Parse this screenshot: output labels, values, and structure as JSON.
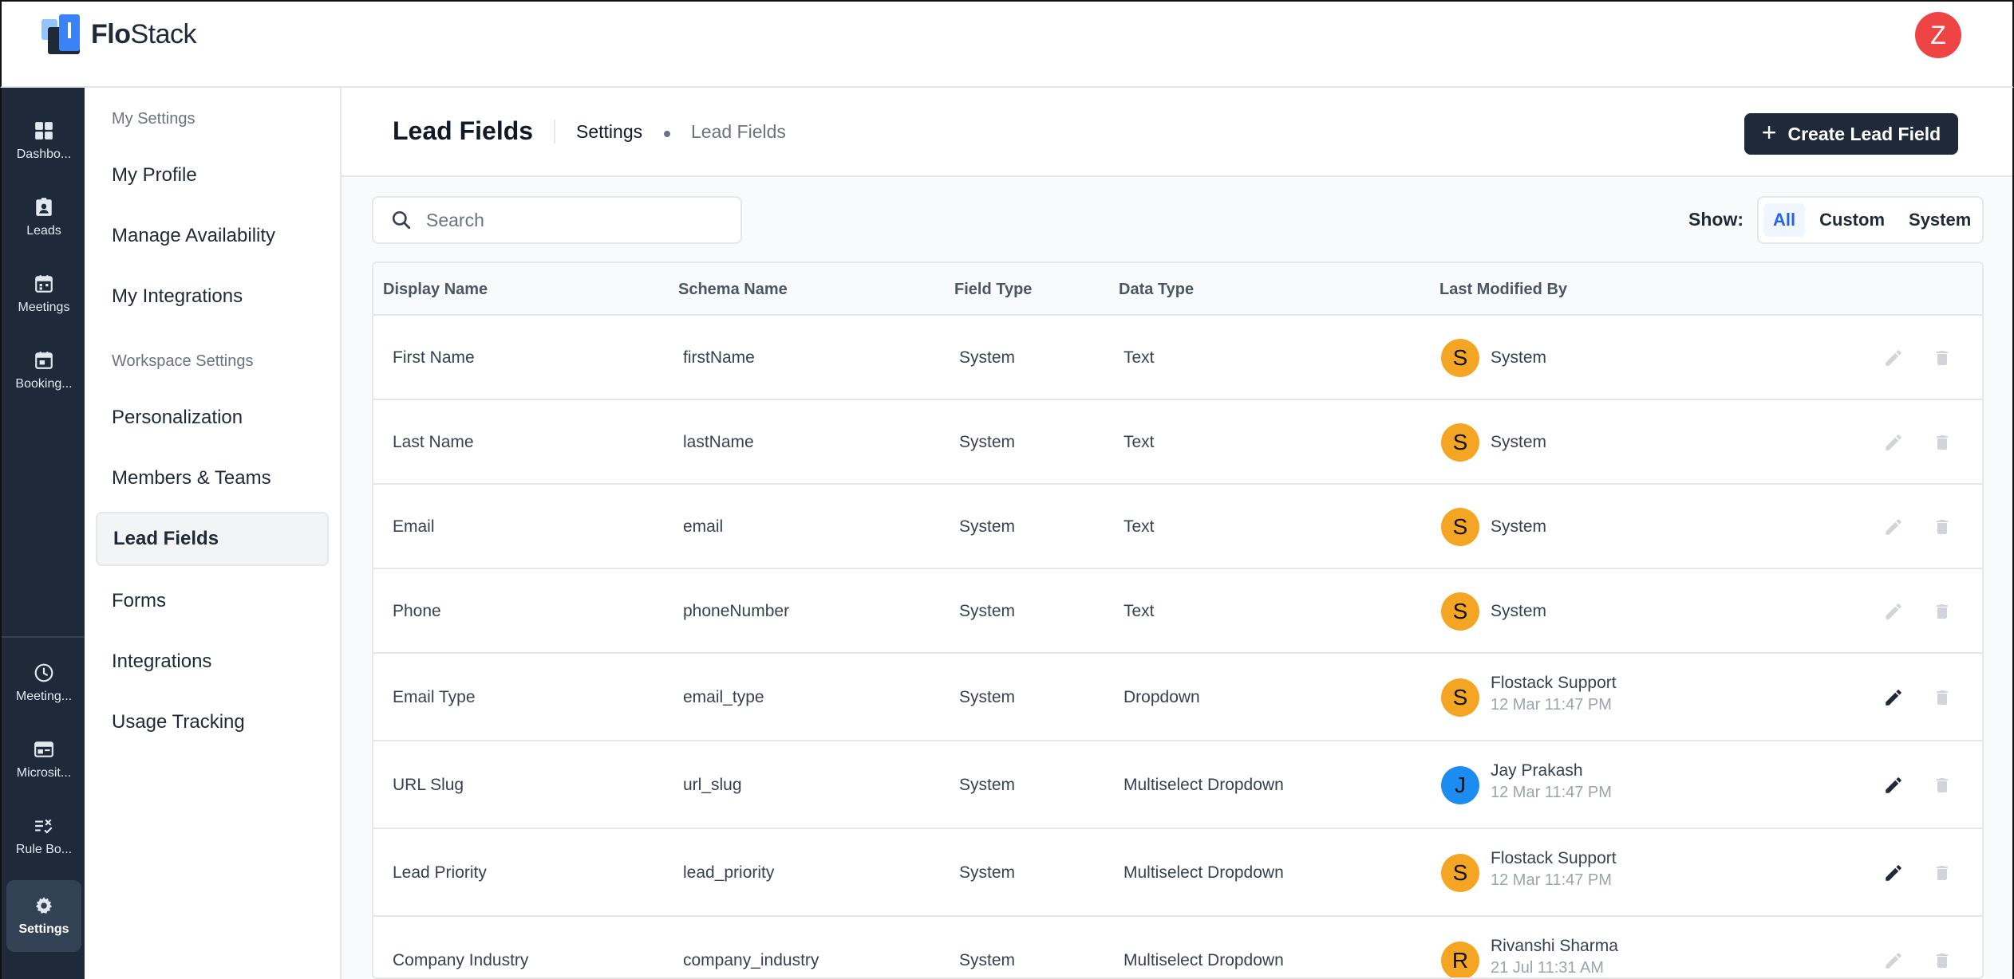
{
  "app": {
    "name_bold": "Flo",
    "name_rest": "Stack",
    "user_initial": "Z",
    "user_avatar_color": "#ef4444"
  },
  "rail": {
    "items": [
      {
        "label": "Dashbo...",
        "icon": "dashboard-icon"
      },
      {
        "label": "Leads",
        "icon": "contact-badge-icon"
      },
      {
        "label": "Meetings",
        "icon": "calendar-icon"
      },
      {
        "label": "Booking...",
        "icon": "calendar-check-icon"
      },
      {
        "label": "Meeting...",
        "icon": "clock-icon"
      },
      {
        "label": "Microsit...",
        "icon": "browser-window-icon"
      },
      {
        "label": "Rule Bo...",
        "icon": "rules-icon"
      },
      {
        "label": "Settings",
        "icon": "gear-icon",
        "active": true
      }
    ]
  },
  "sidebar": {
    "section_my": "My Settings",
    "section_workspace": "Workspace Settings",
    "items": [
      {
        "label": "My Profile"
      },
      {
        "label": "Manage Availability"
      },
      {
        "label": "My Integrations"
      },
      {
        "label": "Personalization"
      },
      {
        "label": "Members & Teams"
      },
      {
        "label": "Lead Fields",
        "active": true
      },
      {
        "label": "Forms"
      },
      {
        "label": "Integrations"
      },
      {
        "label": "Usage Tracking"
      }
    ]
  },
  "header": {
    "title": "Lead Fields",
    "breadcrumb": [
      "Settings",
      "Lead Fields"
    ],
    "create_label": "Create Lead Field"
  },
  "filters": {
    "search_placeholder": "Search",
    "show_label": "Show:",
    "options": [
      "All",
      "Custom",
      "System"
    ],
    "selected": "All"
  },
  "table": {
    "columns": [
      "Display Name",
      "Schema Name",
      "Field Type",
      "Data Type",
      "Last Modified By"
    ],
    "rows": [
      {
        "display": "First Name",
        "schema": "firstName",
        "field_type": "System",
        "data_type": "Text",
        "initial": "S",
        "avatar_color": "#f5a524",
        "modified_by": "System",
        "date": "",
        "editable": false
      },
      {
        "display": "Last Name",
        "schema": "lastName",
        "field_type": "System",
        "data_type": "Text",
        "initial": "S",
        "avatar_color": "#f5a524",
        "modified_by": "System",
        "date": "",
        "editable": false
      },
      {
        "display": "Email",
        "schema": "email",
        "field_type": "System",
        "data_type": "Text",
        "initial": "S",
        "avatar_color": "#f5a524",
        "modified_by": "System",
        "date": "",
        "editable": false
      },
      {
        "display": "Phone",
        "schema": "phoneNumber",
        "field_type": "System",
        "data_type": "Text",
        "initial": "S",
        "avatar_color": "#f5a524",
        "modified_by": "System",
        "date": "",
        "editable": false
      },
      {
        "display": "Email Type",
        "schema": "email_type",
        "field_type": "System",
        "data_type": "Dropdown",
        "initial": "S",
        "avatar_color": "#f5a524",
        "modified_by": "Flostack Support",
        "date": "12 Mar 11:47 PM",
        "editable": true
      },
      {
        "display": "URL Slug",
        "schema": "url_slug",
        "field_type": "System",
        "data_type": "Multiselect Dropdown",
        "initial": "J",
        "avatar_color": "#1d8cf0",
        "modified_by": "Jay Prakash",
        "date": "12 Mar 11:47 PM",
        "editable": true
      },
      {
        "display": "Lead Priority",
        "schema": "lead_priority",
        "field_type": "System",
        "data_type": "Multiselect Dropdown",
        "initial": "S",
        "avatar_color": "#f5a524",
        "modified_by": "Flostack Support",
        "date": "12 Mar 11:47 PM",
        "editable": true
      },
      {
        "display": "Company Industry",
        "schema": "company_industry",
        "field_type": "System",
        "data_type": "Multiselect Dropdown",
        "initial": "R",
        "avatar_color": "#f5a524",
        "modified_by": "Rivanshi Sharma",
        "date": "21 Jul 11:31 AM",
        "editable": false
      }
    ]
  }
}
